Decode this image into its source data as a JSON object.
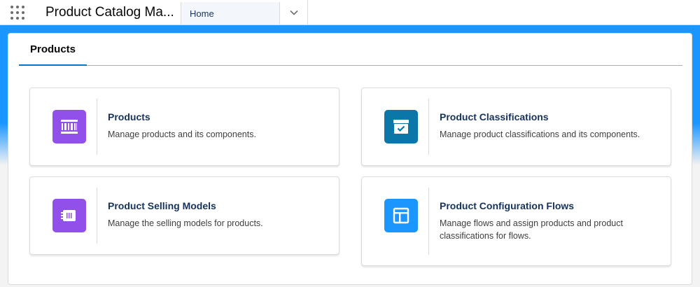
{
  "app": {
    "launcher_icon": "app-launcher-icon",
    "name": "Product Catalog Ma..."
  },
  "nav": {
    "tabs": [
      {
        "label": "Home",
        "active": true
      }
    ],
    "more_icon": "chevron-down-icon"
  },
  "panel": {
    "tab_label": "Products"
  },
  "tiles": [
    {
      "title": "Products",
      "description": "Manage products and its components.",
      "icon": "product-barcode-icon",
      "icon_color": "#9050e9"
    },
    {
      "title": "Product Classifications",
      "description": "Manage product classifications and its components.",
      "icon": "archive-box-icon",
      "icon_color": "#0b77a8"
    },
    {
      "title": "Product Selling Models",
      "description": "Manage the selling models for products.",
      "icon": "chip-icon",
      "icon_color": "#9050e9"
    },
    {
      "title": "Product Configuration Flows",
      "description": "Manage flows and assign products and product classifications for flows.",
      "icon": "layout-icon",
      "icon_color": "#1b96ff"
    }
  ]
}
